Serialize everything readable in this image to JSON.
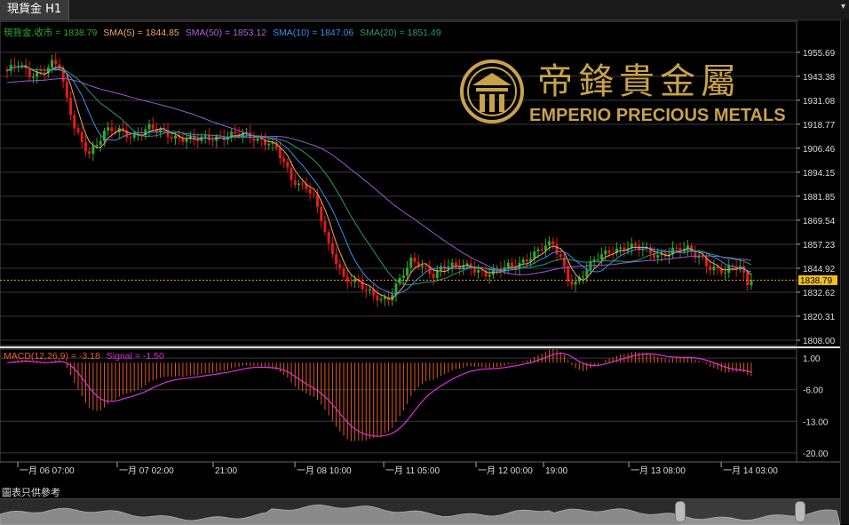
{
  "window": {
    "tab_title": "現貨金 H1",
    "menu_icon": "triangle-down-icon"
  },
  "brand": {
    "cn_name": "帝鋒貴金屬",
    "en_name": "EMPERIO PRECIOUS METALS",
    "logo_icon": "emperio-crest-icon"
  },
  "legend": {
    "price_label": "現貨金,收市 = 1838.79",
    "sma5_label": "SMA(5) = 1844.85",
    "sma50_label": "SMA(50) = 1853.12",
    "sma10_label": "SMA(10) = 1847.06",
    "sma20_label": "SMA(20) = 1851.49",
    "macd_label": "MACD(12,26,9) = -3.18",
    "signal_label": "Signal = -1.50"
  },
  "current_price_tag": "1838.79",
  "footer": {
    "disclaimer": "圖表只供參考"
  },
  "colors": {
    "up": "#2ea82e",
    "down": "#e01b1b",
    "sma5": "#f0a868",
    "sma10": "#3a8ff0",
    "sma20": "#2a9a70",
    "sma50": "#9b59d6",
    "signal": "#e02ee0",
    "macd_bar": "#e05a1e",
    "brand_gold": "#c8a24a",
    "grid": "#3a3a3a"
  },
  "chart_data": [
    {
      "type": "line",
      "title": "現貨金 H1",
      "series_type": "candlestick",
      "ylim": [
        1808.0,
        1962.0
      ],
      "y_ticks": [
        "1955.69",
        "1943.38",
        "1931.08",
        "1918.77",
        "1906.46",
        "1894.15",
        "1881.85",
        "1869.54",
        "1857.23",
        "1844.92",
        "1832.62",
        "1820.31",
        "1808.00"
      ],
      "x_ticks": [
        "一月 06 07:00",
        "一月 07 02:00",
        "21:00",
        "一月 08 10:00",
        "一月 11 05:00",
        "一月 12 00:00",
        "19:00",
        "一月 13 08:00",
        "一月 14 03:00"
      ],
      "anchors": [
        [
          0,
          1946
        ],
        [
          3,
          1949
        ],
        [
          6,
          1944
        ],
        [
          9,
          1946
        ],
        [
          12,
          1950
        ],
        [
          14,
          1948
        ],
        [
          16,
          1930
        ],
        [
          18,
          1918
        ],
        [
          20,
          1910
        ],
        [
          22,
          1905
        ],
        [
          24,
          1908
        ],
        [
          26,
          1914
        ],
        [
          30,
          1916
        ],
        [
          34,
          1913
        ],
        [
          38,
          1916
        ],
        [
          42,
          1915
        ],
        [
          46,
          1912
        ],
        [
          50,
          1910
        ],
        [
          54,
          1912
        ],
        [
          58,
          1913
        ],
        [
          62,
          1913
        ],
        [
          66,
          1912
        ],
        [
          70,
          1910
        ],
        [
          72,
          1906
        ],
        [
          74,
          1898
        ],
        [
          76,
          1890
        ],
        [
          78,
          1888
        ],
        [
          80,
          1888
        ],
        [
          82,
          1882
        ],
        [
          84,
          1870
        ],
        [
          86,
          1855
        ],
        [
          88,
          1848
        ],
        [
          90,
          1840
        ],
        [
          92,
          1840
        ],
        [
          94,
          1838
        ],
        [
          96,
          1833
        ],
        [
          98,
          1830
        ],
        [
          100,
          1828
        ],
        [
          102,
          1830
        ],
        [
          104,
          1837
        ],
        [
          106,
          1843
        ],
        [
          108,
          1848
        ],
        [
          110,
          1846
        ],
        [
          112,
          1844
        ],
        [
          114,
          1842
        ],
        [
          116,
          1846
        ],
        [
          118,
          1847
        ],
        [
          120,
          1845
        ],
        [
          124,
          1845
        ],
        [
          128,
          1843
        ],
        [
          132,
          1844
        ],
        [
          136,
          1846
        ],
        [
          140,
          1852
        ],
        [
          144,
          1856
        ],
        [
          146,
          1856
        ],
        [
          148,
          1850
        ],
        [
          150,
          1840
        ],
        [
          152,
          1838
        ],
        [
          154,
          1842
        ],
        [
          156,
          1846
        ],
        [
          158,
          1850
        ],
        [
          162,
          1855
        ],
        [
          166,
          1856
        ],
        [
          170,
          1854
        ],
        [
          174,
          1852
        ],
        [
          178,
          1854
        ],
        [
          182,
          1854
        ],
        [
          184,
          1852
        ],
        [
          186,
          1850
        ],
        [
          188,
          1846
        ],
        [
          190,
          1844
        ],
        [
          192,
          1842
        ],
        [
          194,
          1845
        ],
        [
          196,
          1846
        ],
        [
          198,
          1838
        ],
        [
          199,
          1838.79
        ]
      ],
      "series": [
        {
          "name": "SMA(5)",
          "period": 5
        },
        {
          "name": "SMA(10)",
          "period": 10
        },
        {
          "name": "SMA(20)",
          "period": 20
        },
        {
          "name": "SMA(50)",
          "period": 50
        }
      ],
      "sma50_start": 1940,
      "grid": true,
      "legend_position": "top-left"
    },
    {
      "type": "bar",
      "title": "MACD(12,26,9)",
      "ylim": [
        -22.0,
        3.0
      ],
      "y_ticks": [
        "1.00",
        "-6.00",
        "-13.00",
        "-20.00"
      ],
      "last_values": {
        "macd": -3.18,
        "signal": -1.5
      },
      "grid": true
    }
  ]
}
